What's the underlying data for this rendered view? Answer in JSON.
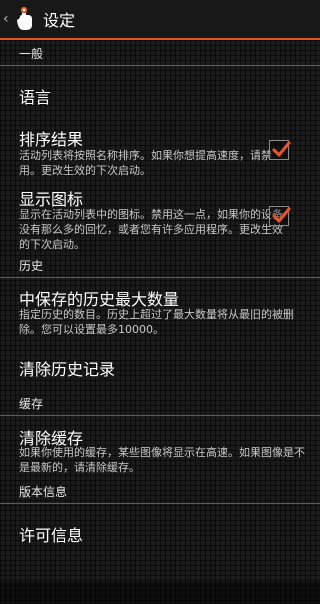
{
  "action_bar": {
    "title": "设定",
    "back_glyph": "‹",
    "icon": "hand-pointer-icon"
  },
  "categories": {
    "general": "一般",
    "history": "历史",
    "cache": "缓存",
    "version": "版本信息"
  },
  "prefs": {
    "language": {
      "title": "语言"
    },
    "sort_results": {
      "title": "排序结果",
      "summary": "活动列表将按照名称排序。如果你想提高速度，请禁用。更改生效的下次启动。",
      "checked": true
    },
    "show_icons": {
      "title": "显示图标",
      "summary": "显示在活动列表中的图标。禁用这一点，如果你的设备没有那么多的回忆，或者您有许多应用程序。更改生效的下次启动。",
      "checked": true
    },
    "max_history": {
      "title": "中保存的历史最大数量",
      "summary": "指定历史的数目。历史上超过了最大数量将从最旧的被删除。您可以设置最多10000。"
    },
    "clear_history": {
      "title": "清除历史记录"
    },
    "clear_cache": {
      "title": "清除缓存",
      "summary": "如果你使用的缓存，某些图像将显示在高速。如果图像是不是最新的，请清除缓存。"
    },
    "license": {
      "title": "许可信息"
    }
  },
  "colors": {
    "accent": "#e2531f",
    "checkmark": "#e5532a"
  }
}
